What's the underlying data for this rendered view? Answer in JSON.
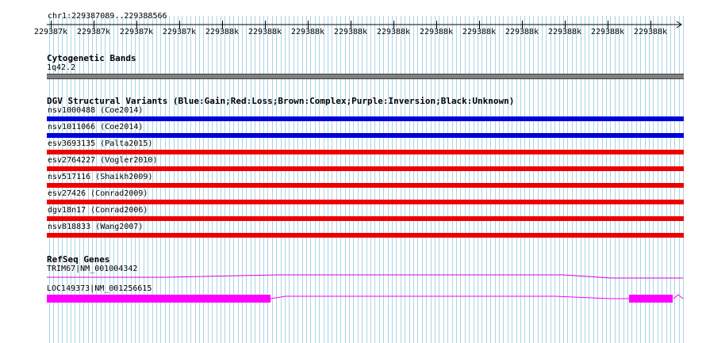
{
  "ruler": {
    "position": "chr1:229387089..229388566",
    "ticks": [
      "229387k",
      "229387k",
      "229387k",
      "229387k",
      "229388k",
      "229388k",
      "229388k",
      "229388k",
      "229388k",
      "229388k",
      "229388k",
      "229388k",
      "229388k",
      "229388k",
      "229388k"
    ]
  },
  "cytoband": {
    "title": "Cytogenetic Bands",
    "label": "1q42.2",
    "color": "#808080"
  },
  "dgv": {
    "title": "DGV Structural Variants (Blue:Gain;Red:Loss;Brown:Complex;Purple:Inversion;Black:Unknown)",
    "variants": [
      {
        "label": "nsv1000488 (Coe2014)",
        "type": "Gain",
        "color": "#0000dd"
      },
      {
        "label": "nsv1011066 (Coe2014)",
        "type": "Gain",
        "color": "#0000dd"
      },
      {
        "label": "esv3693135 (Palta2015)",
        "type": "Loss",
        "color": "#ee0000"
      },
      {
        "label": "esv2764227 (Vogler2010)",
        "type": "Loss",
        "color": "#ee0000"
      },
      {
        "label": "nsv517116 (Shaikh2009)",
        "type": "Loss",
        "color": "#ee0000"
      },
      {
        "label": "esv27426 (Conrad2009)",
        "type": "Loss",
        "color": "#ee0000"
      },
      {
        "label": "dgv18n17 (Conrad2006)",
        "type": "Loss",
        "color": "#ee0000"
      },
      {
        "label": "nsv818833 (Wang2007)",
        "type": "Loss",
        "color": "#ee0000"
      }
    ]
  },
  "refseq": {
    "title": "RefSeq Genes",
    "genes": [
      {
        "label": "TRIM67|NM_001004342",
        "color": "#dd00dd"
      },
      {
        "label": "LOC149373|NM_001256615",
        "color": "#ff00ff"
      }
    ]
  },
  "colors": {
    "grid": "#aad4e6",
    "axis": "#000000"
  }
}
